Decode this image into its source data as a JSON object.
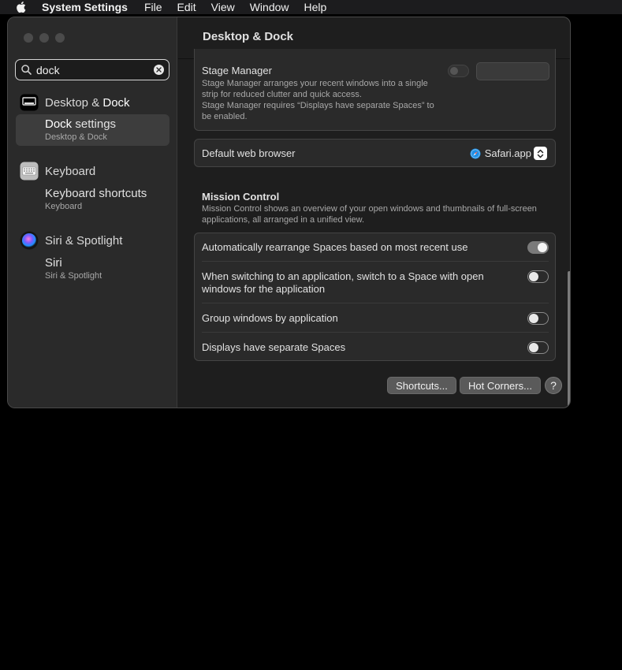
{
  "menubar": {
    "app_name": "System Settings",
    "items": [
      "File",
      "Edit",
      "View",
      "Window",
      "Help"
    ]
  },
  "sidebar": {
    "search_value": "dock",
    "groups": [
      {
        "icon": "desktop-dock-icon",
        "header_prefix": "Desktop & ",
        "header_match": "Dock",
        "result_match": "Dock",
        "result_rest": " settings",
        "result_subtitle": "Desktop & Dock",
        "selected": true
      },
      {
        "icon": "keyboard-icon",
        "header": "Keyboard",
        "result_title": "Keyboard shortcuts",
        "result_subtitle": "Keyboard"
      },
      {
        "icon": "siri-icon",
        "header": "Siri & Spotlight",
        "result_title": "Siri",
        "result_subtitle": "Siri & Spotlight"
      }
    ]
  },
  "main": {
    "title": "Desktop & Dock",
    "stage_manager": {
      "name": "Stage Manager",
      "desc1": "Stage Manager arranges your recent windows into a single strip for reduced clutter and quick access.",
      "desc2": "Stage Manager requires “Displays have separate Spaces” to be enabled."
    },
    "default_browser": {
      "label": "Default web browser",
      "value": "Safari.app"
    },
    "mission_control": {
      "title": "Mission Control",
      "desc": "Mission Control shows an overview of your open windows and thumbnails of full-screen applications, all arranged in a unified view.",
      "options": [
        {
          "label": "Automatically rearrange Spaces based on most recent use",
          "on": true
        },
        {
          "label": "When switching to an application, switch to a Space with open windows for the application",
          "on": false
        },
        {
          "label": "Group windows by application",
          "on": false
        },
        {
          "label": "Displays have separate Spaces",
          "on": false
        }
      ]
    },
    "buttons": {
      "shortcuts": "Shortcuts...",
      "hot_corners": "Hot Corners...",
      "help": "?"
    }
  },
  "colors": {
    "background": "#000000",
    "window": "#1e1e1e",
    "sidebar": "#2a2a2a",
    "selected_row": "#3d3d3d",
    "toggle_on": "#7a7a7a"
  }
}
